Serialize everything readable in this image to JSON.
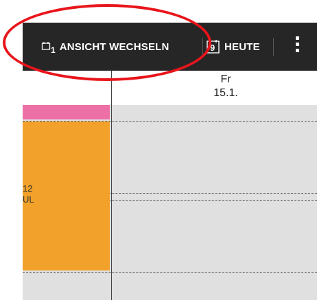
{
  "toolbar": {
    "switch_view_label": "ANSICHT WECHSELN",
    "switch_view_icon_sub": "1",
    "today_label": "HEUTE",
    "today_icon_num": "9"
  },
  "calendar": {
    "day_name": "Fr",
    "day_date": "15.1.",
    "event_text_line1": "12",
    "event_text_line2": "UL"
  },
  "colors": {
    "toolbar_bg": "#262626",
    "pink_event": "#ec6fa6",
    "orange_event": "#f2a12a",
    "grid_bg": "#e0e0e0",
    "annotation": "#e8151b"
  }
}
